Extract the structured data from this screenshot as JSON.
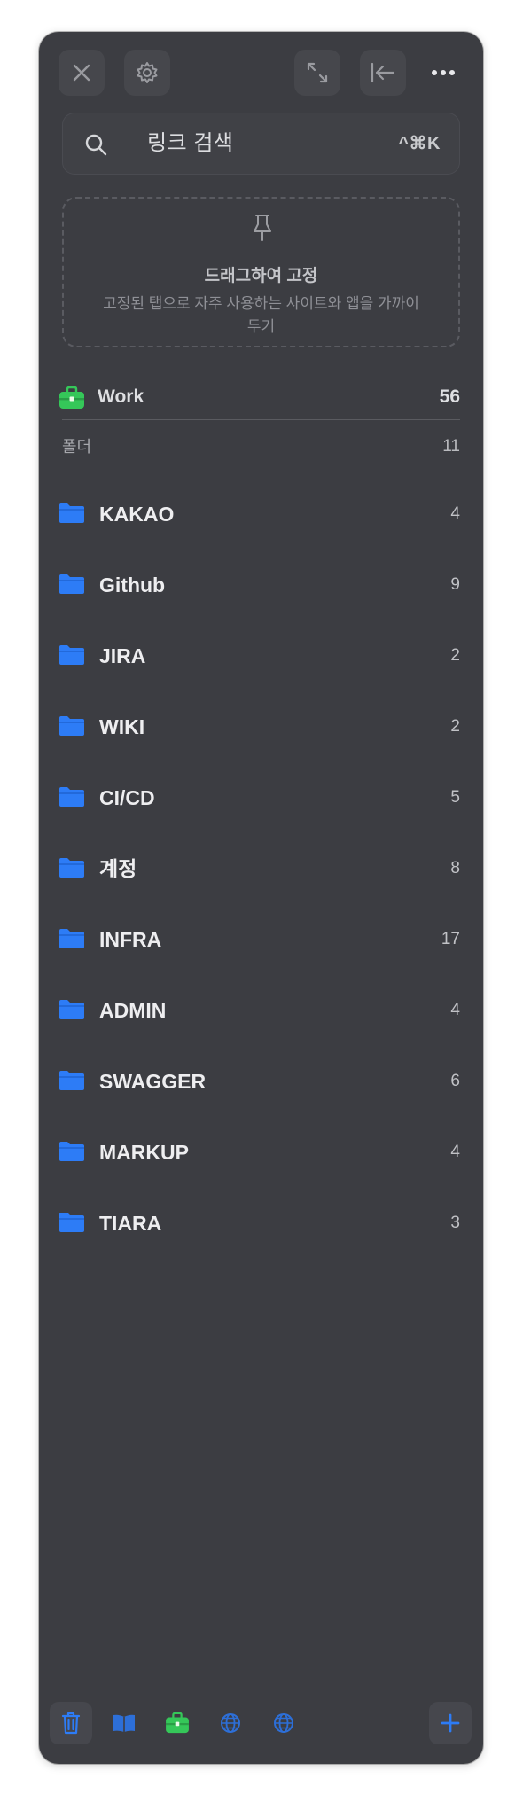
{
  "toolbar": {
    "close_icon": "close-icon",
    "settings_icon": "gear-icon",
    "expand_icon": "expand-icon",
    "collapse_icon": "collapse-left-icon",
    "more_icon": "more-dots-icon"
  },
  "search": {
    "placeholder": "링크 검색",
    "shortcut": "^⌘K"
  },
  "pin_zone": {
    "title": "드래그하여 고정",
    "description": "고정된 탭으로 자주 사용하는 사이트와 앱을 가까이 두기"
  },
  "space": {
    "name": "Work",
    "count": "56",
    "icon": "briefcase-icon"
  },
  "folders_section": {
    "label": "폴더",
    "count": "11",
    "items": [
      {
        "name": "KAKAO",
        "count": "4"
      },
      {
        "name": "Github",
        "count": "9"
      },
      {
        "name": "JIRA",
        "count": "2"
      },
      {
        "name": "WIKI",
        "count": "2"
      },
      {
        "name": "CI/CD",
        "count": "5"
      },
      {
        "name": "계정",
        "count": "8"
      },
      {
        "name": "INFRA",
        "count": "17"
      },
      {
        "name": "ADMIN",
        "count": "4"
      },
      {
        "name": "SWAGGER",
        "count": "6"
      },
      {
        "name": "MARKUP",
        "count": "4"
      },
      {
        "name": "TIARA",
        "count": "3"
      }
    ]
  },
  "bottom_bar": {
    "items": [
      "trash-icon",
      "book-icon",
      "briefcase-icon",
      "globe-icon",
      "globe-icon"
    ],
    "add_icon": "plus-icon"
  },
  "colors": {
    "panel_bg": "#3c3d42",
    "accent_blue": "#2d7cf6",
    "work_green": "#35c759"
  }
}
